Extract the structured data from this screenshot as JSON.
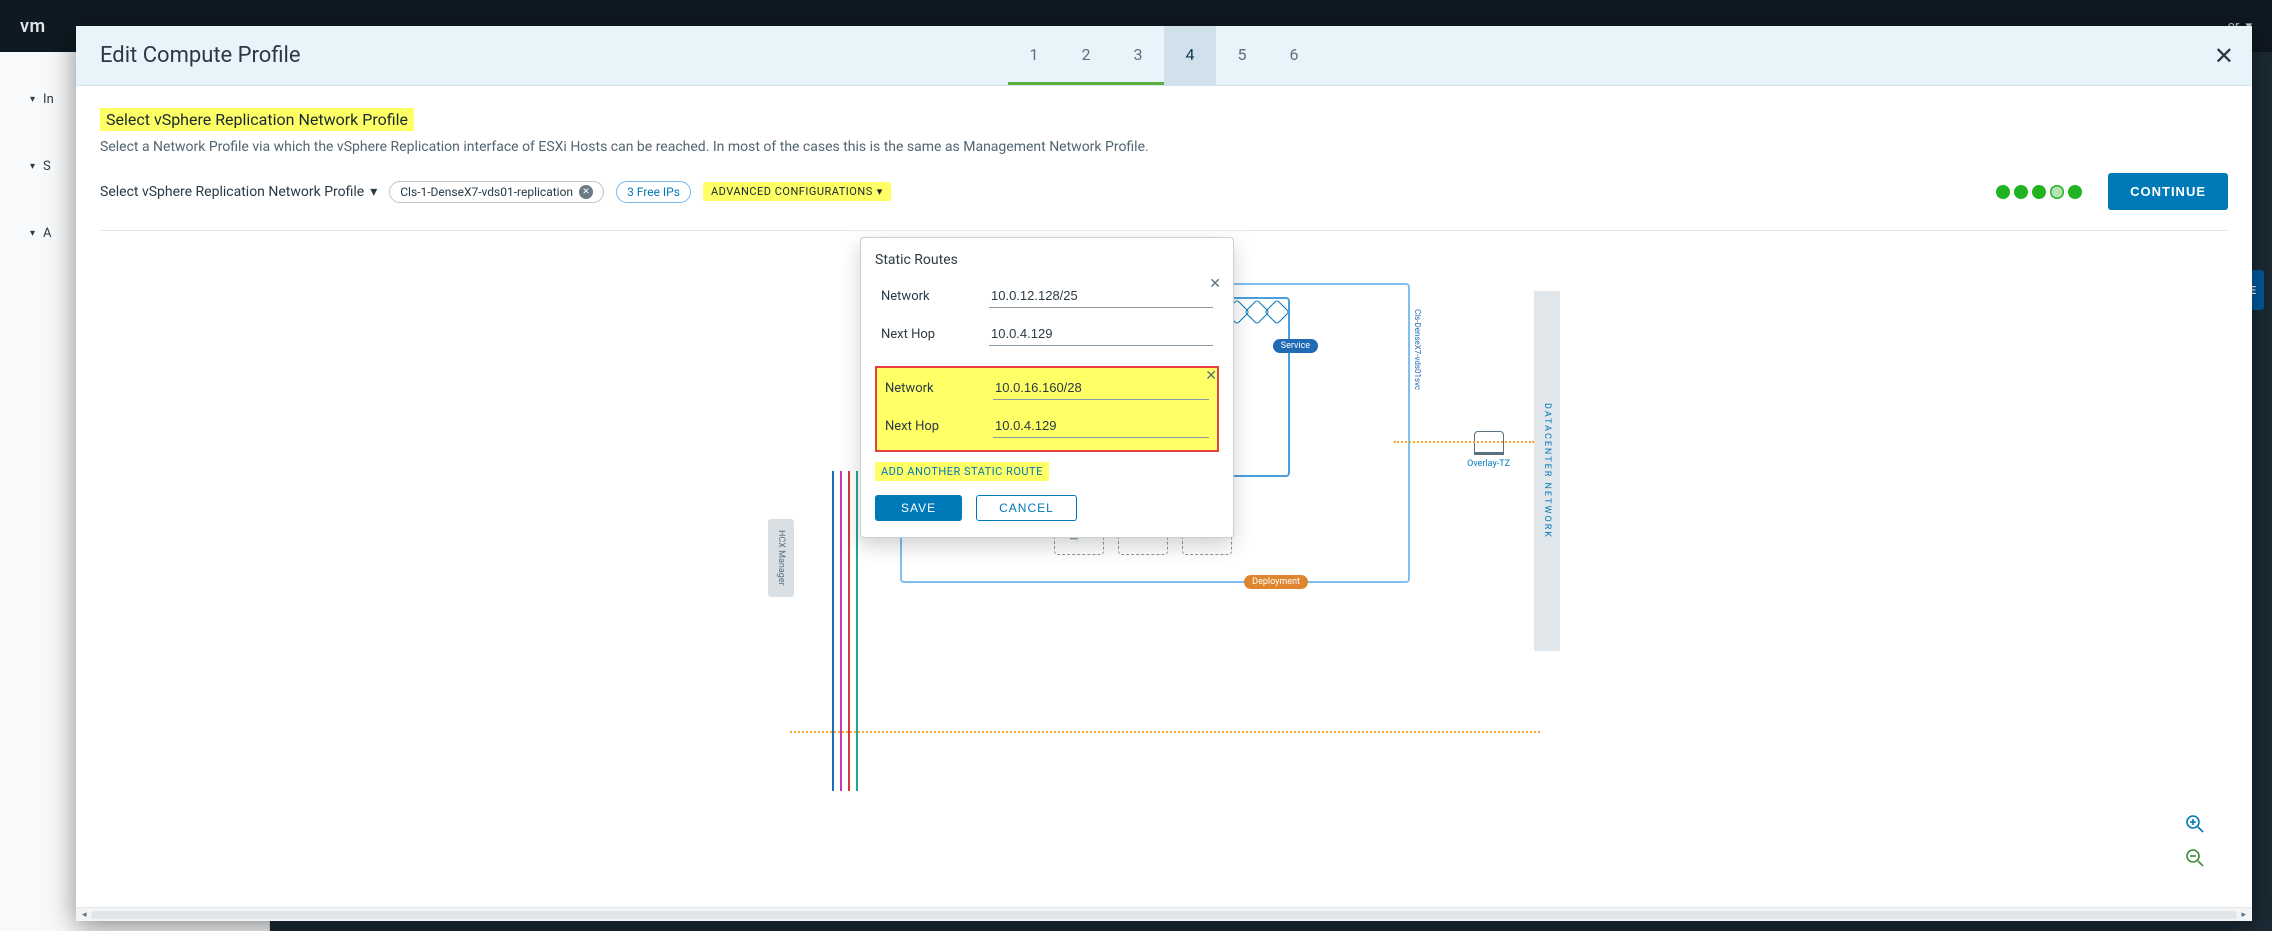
{
  "bg": {
    "logo": "vm",
    "user_suffix": "or",
    "sidebar": {
      "item_in_prefix": "In",
      "item_si_prefix": "S",
      "item_a_prefix": "A"
    },
    "right_btn": "LE"
  },
  "modal": {
    "title": "Edit Compute Profile",
    "steps": [
      "1",
      "2",
      "3",
      "4",
      "5",
      "6"
    ],
    "active_step_index": 3,
    "done_step_count": 3
  },
  "section": {
    "heading": "Select vSphere Replication Network Profile",
    "description": "Select a Network Profile via which the vSphere Replication interface of ESXi Hosts can be reached. In most of the cases this is the same as Management Network Profile.",
    "row_label": "Select vSphere Replication Network Profile",
    "chip_profile": "Cls-1-DenseX7-vds01-replication",
    "chip_freeips": "3 Free IPs",
    "advanced": "ADVANCED CONFIGURATIONS",
    "continue": "CONTINUE"
  },
  "popover": {
    "title": "Static Routes",
    "routes": [
      {
        "network_label": "Network",
        "network": "10.0.12.128/25",
        "nexthop_label": "Next Hop",
        "nexthop": "10.0.4.129"
      },
      {
        "network_label": "Network",
        "network": "10.0.16.160/28",
        "nexthop_label": "Next Hop",
        "nexthop": "10.0.4.129"
      }
    ],
    "add_route": "ADD ANOTHER STATIC ROUTE",
    "save": "SAVE",
    "cancel": "CANCEL"
  },
  "diagram": {
    "hcx_manager": "HCX Manager",
    "dc_network": "DATACENTER NETWORK",
    "vert_label": "Cls-DenseX7-vds01svc",
    "service_pill": "Service",
    "deployment_pill": "Deployment",
    "overlay_label": "Overlay-TZ"
  }
}
